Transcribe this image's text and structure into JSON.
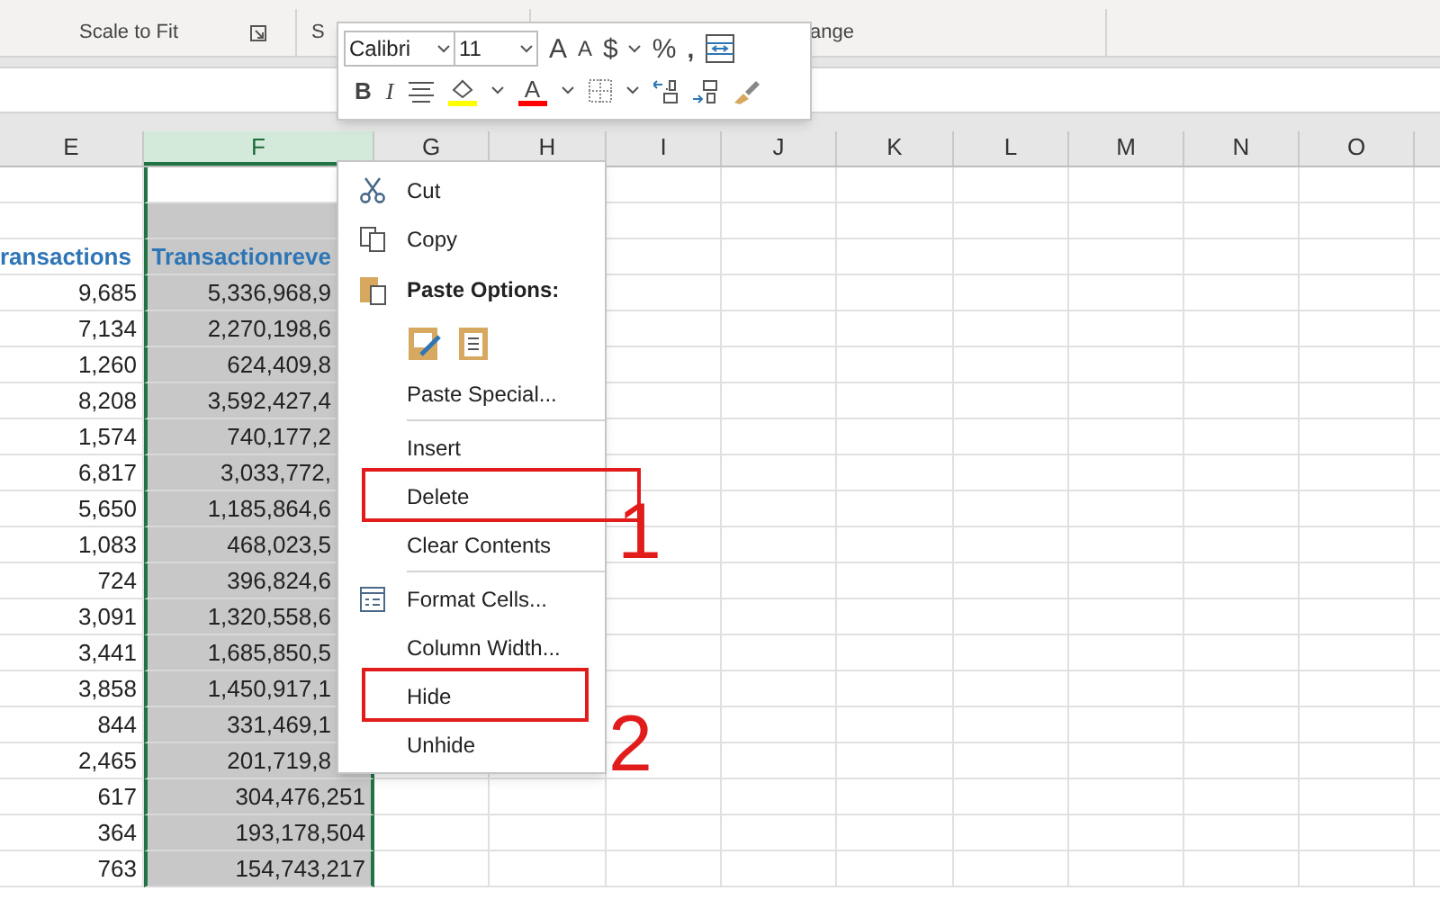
{
  "ribbon": {
    "groups": [
      {
        "label": "Scale to Fit",
        "launcher": true
      },
      {
        "label": "S",
        "launcher": false
      },
      {
        "label": "ange",
        "launcher": false
      }
    ]
  },
  "columns": [
    {
      "label": "E",
      "selected": false
    },
    {
      "label": "F",
      "selected": true
    },
    {
      "label": "G",
      "selected": false
    },
    {
      "label": "H",
      "selected": false
    },
    {
      "label": "I",
      "selected": false
    },
    {
      "label": "J",
      "selected": false
    },
    {
      "label": "K",
      "selected": false
    },
    {
      "label": "L",
      "selected": false
    },
    {
      "label": "M",
      "selected": false
    },
    {
      "label": "N",
      "selected": false
    },
    {
      "label": "O",
      "selected": false
    }
  ],
  "rows": [
    {
      "kind": "data",
      "cells": [
        "",
        ""
      ]
    },
    {
      "kind": "data",
      "cells": [
        "",
        ""
      ]
    },
    {
      "kind": "header",
      "cells": [
        "ransactions",
        "Transactionreve"
      ]
    },
    {
      "kind": "data",
      "cells": [
        "9,685",
        "5,336,968,9"
      ]
    },
    {
      "kind": "data",
      "cells": [
        "7,134",
        "2,270,198,6"
      ]
    },
    {
      "kind": "data",
      "cells": [
        "1,260",
        "624,409,8"
      ]
    },
    {
      "kind": "data",
      "cells": [
        "8,208",
        "3,592,427,4"
      ]
    },
    {
      "kind": "data",
      "cells": [
        "1,574",
        "740,177,2"
      ]
    },
    {
      "kind": "data",
      "cells": [
        "6,817",
        "3,033,772,"
      ]
    },
    {
      "kind": "data",
      "cells": [
        "5,650",
        "1,185,864,6"
      ]
    },
    {
      "kind": "data",
      "cells": [
        "1,083",
        "468,023,5"
      ]
    },
    {
      "kind": "data",
      "cells": [
        "724",
        "396,824,6"
      ]
    },
    {
      "kind": "data",
      "cells": [
        "3,091",
        "1,320,558,6"
      ]
    },
    {
      "kind": "data",
      "cells": [
        "3,441",
        "1,685,850,5"
      ]
    },
    {
      "kind": "data",
      "cells": [
        "3,858",
        "1,450,917,1"
      ]
    },
    {
      "kind": "data",
      "cells": [
        "844",
        "331,469,1"
      ]
    },
    {
      "kind": "data",
      "cells": [
        "2,465",
        "201,719,8"
      ]
    },
    {
      "kind": "data",
      "cells": [
        "617",
        "304,476,251"
      ]
    },
    {
      "kind": "data",
      "cells": [
        "364",
        "193,178,504"
      ]
    },
    {
      "kind": "data",
      "cells": [
        "763",
        "154,743,217"
      ]
    }
  ],
  "mini_toolbar": {
    "font": "Calibri",
    "size": "11",
    "row_1": [
      "A",
      "A",
      "$",
      "%",
      ","
    ],
    "row_2": [
      "B",
      "I",
      "A"
    ]
  },
  "context_menu": {
    "items": [
      {
        "kind": "item",
        "label": "Cut"
      },
      {
        "kind": "item",
        "label": "Copy"
      },
      {
        "kind": "heading",
        "label": "Paste Options:"
      },
      {
        "kind": "paste_icons"
      },
      {
        "kind": "item",
        "label": "Paste Special..."
      },
      {
        "kind": "separator"
      },
      {
        "kind": "item",
        "label": "Insert"
      },
      {
        "kind": "item",
        "label": "Delete"
      },
      {
        "kind": "item",
        "label": "Clear Contents"
      },
      {
        "kind": "separator"
      },
      {
        "kind": "item",
        "label": "Format Cells..."
      },
      {
        "kind": "item",
        "label": "Column Width..."
      },
      {
        "kind": "item",
        "label": "Hide"
      },
      {
        "kind": "item",
        "label": "Unhide"
      }
    ]
  },
  "annotations": [
    {
      "label": "1"
    },
    {
      "label": "2"
    }
  ]
}
